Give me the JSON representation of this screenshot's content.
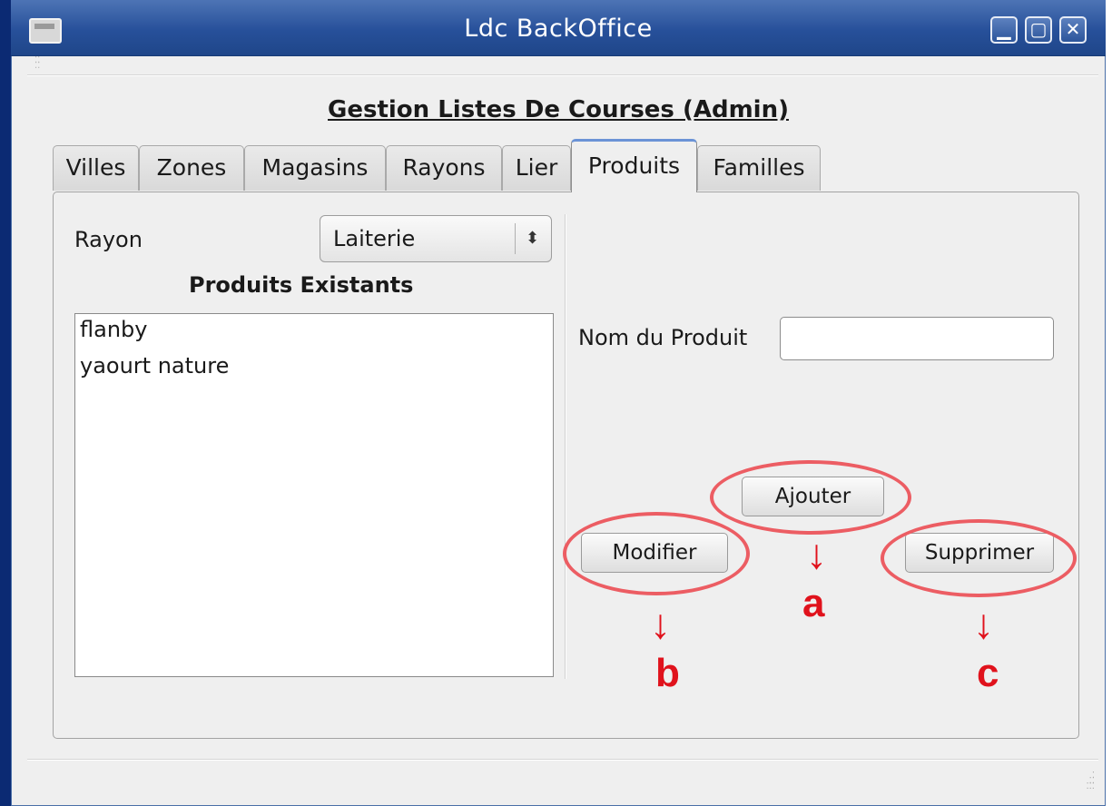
{
  "window": {
    "title": "Ldc BackOffice",
    "controls": {
      "minimize": "▁",
      "maximize": "▢",
      "close": "✕"
    }
  },
  "heading": "Gestion Listes De Courses (Admin)",
  "tabs": [
    {
      "label": "Villes"
    },
    {
      "label": "Zones"
    },
    {
      "label": "Magasins"
    },
    {
      "label": "Rayons"
    },
    {
      "label": "Lier"
    },
    {
      "label": "Produits",
      "active": true
    },
    {
      "label": "Familles"
    }
  ],
  "left": {
    "rayon_label": "Rayon",
    "rayon_value": "Laiterie",
    "combo_arrow": "⬍",
    "list_title": "Produits Existants",
    "products": [
      "flanby",
      "yaourt nature"
    ]
  },
  "right": {
    "name_label": "Nom du Produit",
    "name_value": "",
    "buttons": {
      "add": "Ajouter",
      "modify": "Modifier",
      "delete": "Supprimer"
    }
  },
  "annotations": {
    "color": "#e0121c",
    "a": "a",
    "b": "b",
    "c": "c",
    "arrow": "↓"
  },
  "colors": {
    "titlebar": "#27509a",
    "annotation": "#ec5d63"
  }
}
